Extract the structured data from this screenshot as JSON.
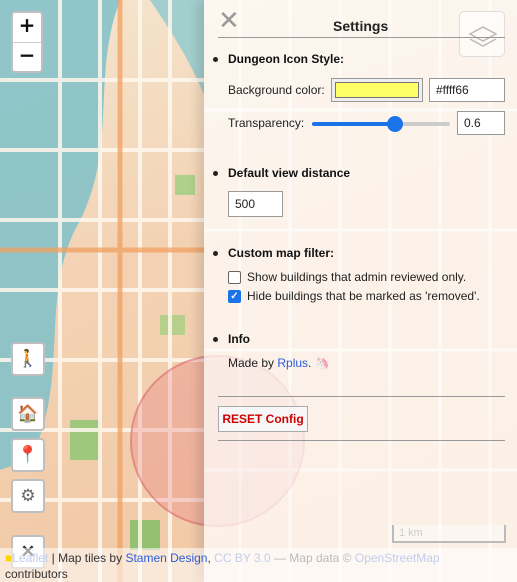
{
  "zoom": {
    "in_label": "+",
    "out_label": "−"
  },
  "left_buttons": {
    "walk_icon": "🚶",
    "home_icon": "🏠",
    "pin_icon": "📍",
    "gear_icon": "⚙",
    "close_icon": "✕"
  },
  "settings": {
    "title": "Settings",
    "close_label": "✕",
    "icon_style": {
      "heading": "Dungeon Icon Style:",
      "bg_label": "Background color:",
      "bg_color": "#ffff66",
      "bg_value": "#ffff66",
      "transparency_label": "Transparency:",
      "transparency_value": "0.6",
      "transparency_fraction": 0.6
    },
    "view_distance": {
      "heading": "Default view distance",
      "value": "500"
    },
    "filter": {
      "heading": "Custom map filter:",
      "options": [
        {
          "label": "Show buildings that admin reviewed only.",
          "checked": false
        },
        {
          "label": "Hide buildings that be marked as 'removed'.",
          "checked": true
        }
      ]
    },
    "info": {
      "heading": "Info",
      "made_by_prefix": "Made by ",
      "author": "Rplus",
      "suffix": ".",
      "emoji": "🦄"
    },
    "reset_label": "RESET Config"
  },
  "scale": {
    "label": "1 km"
  },
  "attribution": {
    "leaflet": "Leaflet",
    "sep1": " | Map tiles by ",
    "stamen": "Stamen Design",
    "sep2": ", ",
    "license": "CC BY 3.0",
    "sep3": " — Map data © ",
    "osm": "OpenStreetMap",
    "contributors": "contributors"
  },
  "colors": {
    "accent": "#1a73e8",
    "reset_text": "#d00000",
    "link": "#2b5dd8"
  }
}
